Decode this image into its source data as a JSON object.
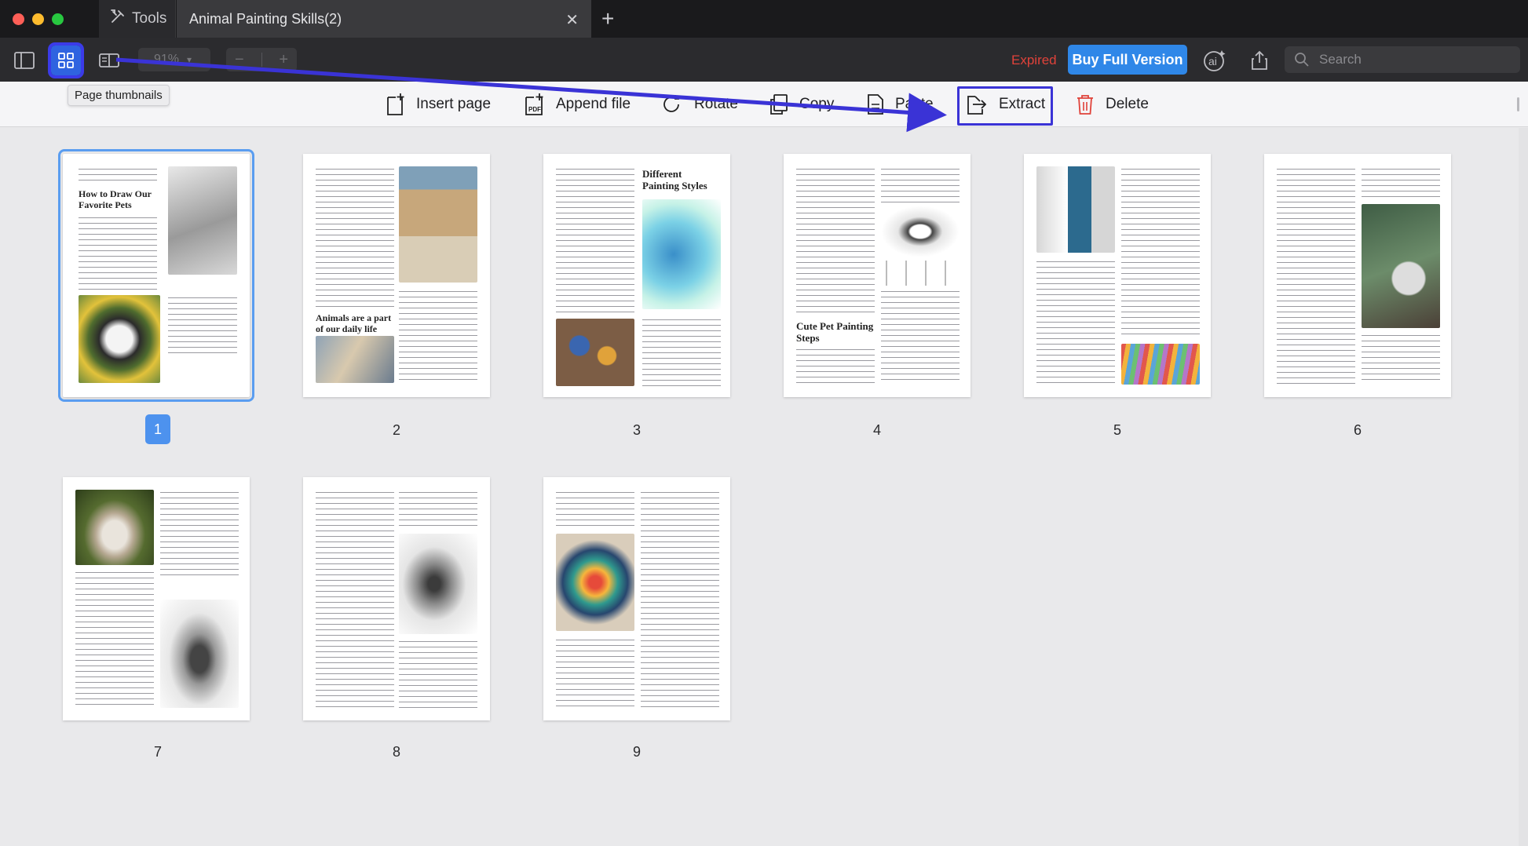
{
  "titlebar": {
    "tools_label": "Tools",
    "doc_tab_title": "Animal Painting Skills(2)"
  },
  "toolbar": {
    "zoom_value": "91%",
    "expired_label": "Expired",
    "buy_label": "Buy Full Version",
    "search_placeholder": "Search"
  },
  "tooltip": {
    "text": "Page thumbnails"
  },
  "page_actions": [
    {
      "label": "Insert page"
    },
    {
      "label": "Append file"
    },
    {
      "label": "Rotate"
    },
    {
      "label": "Copy"
    },
    {
      "label": "Paste"
    },
    {
      "label": "Extract"
    },
    {
      "label": "Delete"
    }
  ],
  "pages": [
    {
      "number": "1",
      "selected": true,
      "headings": [
        "How to Draw Our Favorite Pets"
      ]
    },
    {
      "number": "2",
      "headings": [
        "Animals are a part of our daily life"
      ]
    },
    {
      "number": "3",
      "headings": [
        "Different Painting Styles"
      ]
    },
    {
      "number": "4",
      "headings": [
        "Cute Pet Painting Steps"
      ]
    },
    {
      "number": "5",
      "headings": []
    },
    {
      "number": "6",
      "headings": []
    },
    {
      "number": "7",
      "headings": []
    },
    {
      "number": "8",
      "headings": []
    },
    {
      "number": "9",
      "headings": []
    }
  ],
  "colors": {
    "accent": "#2f87e8",
    "selection": "#4d92ee",
    "annotation": "#3a33d6",
    "expired": "#e0423a"
  }
}
